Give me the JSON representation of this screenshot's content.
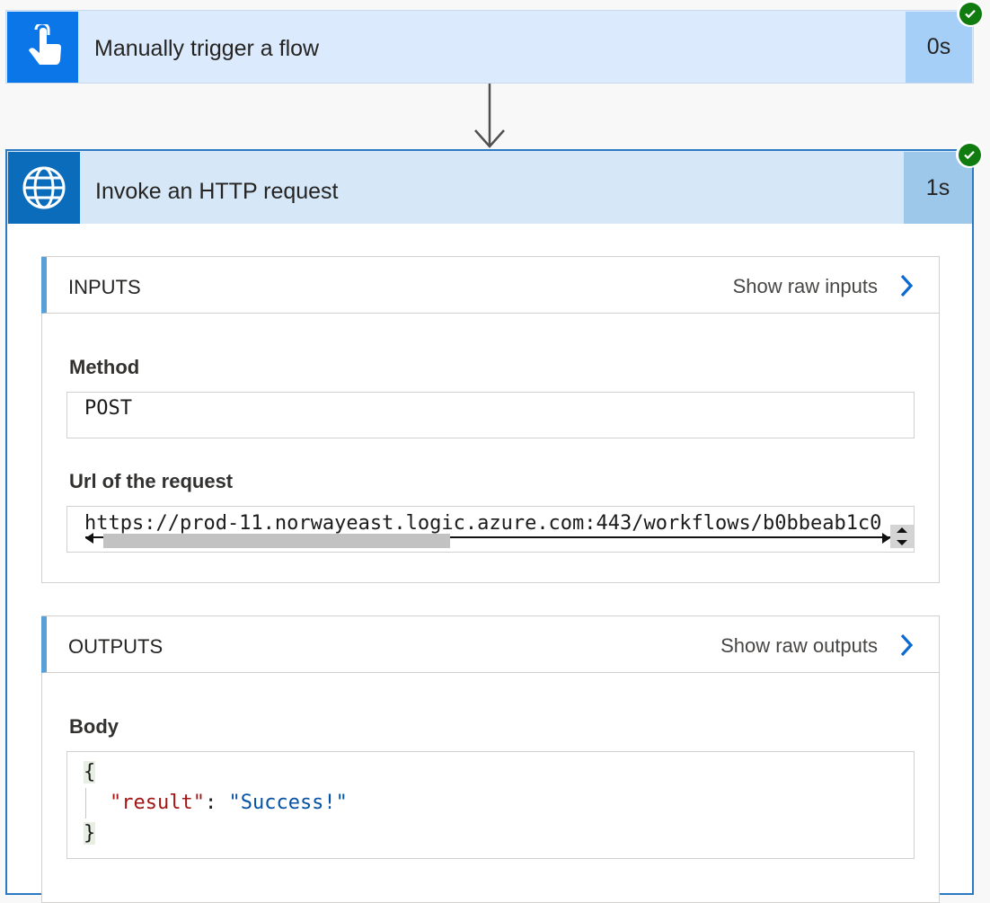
{
  "trigger": {
    "title": "Manually trigger a flow",
    "duration": "0s",
    "icon": "touch-hand-icon",
    "status": "succeeded"
  },
  "action": {
    "title": "Invoke an HTTP request",
    "duration": "1s",
    "icon": "globe-icon",
    "status": "succeeded",
    "inputs": {
      "label": "INPUTS",
      "raw_link": "Show raw inputs",
      "method_label": "Method",
      "method_value": "POST",
      "url_label": "Url of the request",
      "url_value": "https://prod-11.norwayeast.logic.azure.com:443/workflows/b0bbeab1c0"
    },
    "outputs": {
      "label": "OUTPUTS",
      "raw_link": "Show raw outputs",
      "body_label": "Body",
      "body_open": "{",
      "body_key": "\"result\"",
      "body_colon": ": ",
      "body_value": "\"Success!\"",
      "body_close": "}"
    }
  },
  "colors": {
    "trigger_tile": "#0a76e8",
    "action_tile": "#0b6cbc",
    "success": "#107c10",
    "link_chevron": "#0a6ad4"
  }
}
